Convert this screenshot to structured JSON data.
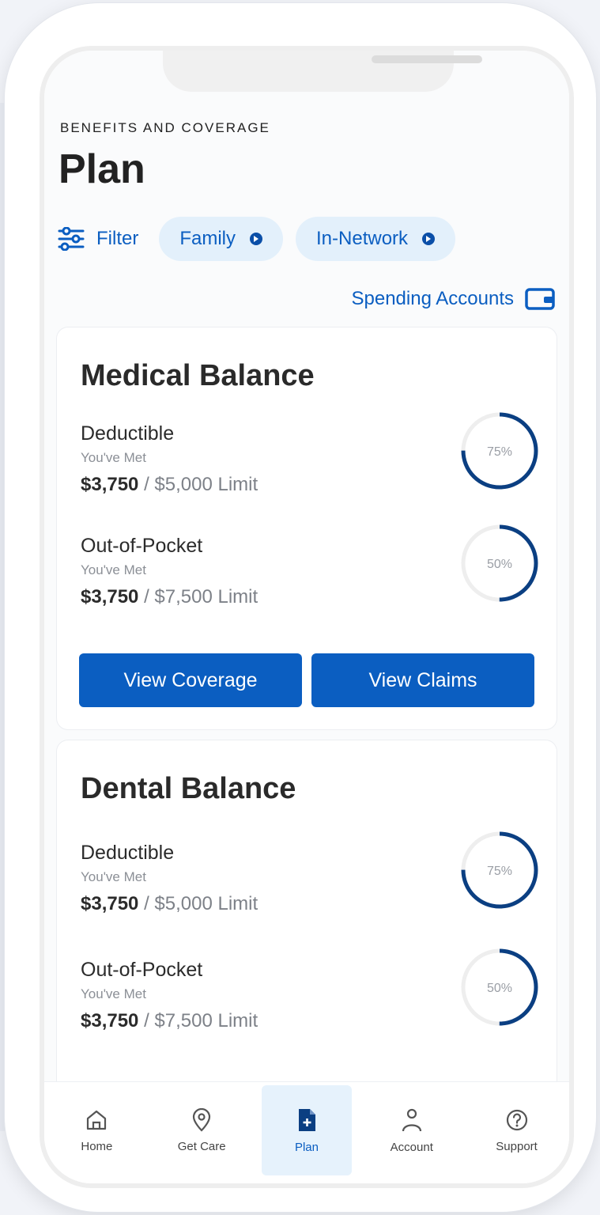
{
  "header": {
    "eyebrow": "BENEFITS AND COVERAGE",
    "title": "Plan"
  },
  "filters": {
    "filter_label": "Filter",
    "chips": [
      "Family",
      "In-Network"
    ]
  },
  "spending_link": "Spending Accounts",
  "medical": {
    "title": "Medical Balance",
    "deductible": {
      "label": "Deductible",
      "sub": "You've Met",
      "met": "$3,750",
      "limit": "/ $5,000 Limit",
      "percent_text": "75%",
      "fraction": 0.75
    },
    "oop": {
      "label": "Out-of-Pocket",
      "sub": "You've Met",
      "met": "$3,750",
      "limit": "/ $7,500 Limit",
      "percent_text": "50%",
      "fraction": 0.5
    },
    "buttons": [
      "View Coverage",
      "View Claims"
    ]
  },
  "dental": {
    "title": "Dental Balance",
    "deductible": {
      "label": "Deductible",
      "sub": "You've Met",
      "met": "$3,750",
      "limit": "/ $5,000 Limit",
      "percent_text": "75%",
      "fraction": 0.75
    },
    "oop": {
      "label": "Out-of-Pocket",
      "sub": "You've Met",
      "met": "$3,750",
      "limit": "/ $7,500 Limit",
      "percent_text": "50%",
      "fraction": 0.5
    }
  },
  "tabs": [
    {
      "label": "Home",
      "icon": "home-icon"
    },
    {
      "label": "Get Care",
      "icon": "location-pin-icon"
    },
    {
      "label": "Plan",
      "icon": "document-plus-icon",
      "active": true
    },
    {
      "label": "Account",
      "icon": "person-icon"
    },
    {
      "label": "Support",
      "icon": "help-circle-icon"
    }
  ],
  "colors": {
    "accent": "#0b5ec1",
    "ring": "#0b3f82",
    "ring_track": "#eeeeee",
    "chip_bg": "#e3f0fb"
  }
}
